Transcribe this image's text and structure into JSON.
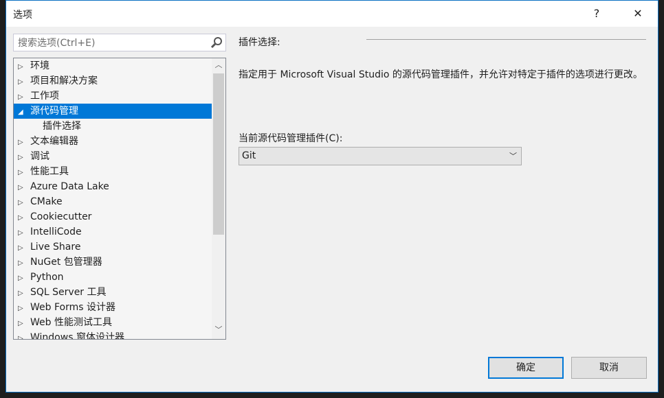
{
  "dialog": {
    "title": "选项",
    "help": "?",
    "close": "✕"
  },
  "search": {
    "placeholder": "搜索选项(Ctrl+E)"
  },
  "tree": {
    "items": [
      {
        "label": "环境",
        "expanded": false
      },
      {
        "label": "项目和解决方案",
        "expanded": false
      },
      {
        "label": "工作项",
        "expanded": false
      },
      {
        "label": "源代码管理",
        "expanded": true,
        "selected": true
      },
      {
        "label": "插件选择",
        "child": true
      },
      {
        "label": "文本编辑器",
        "expanded": false
      },
      {
        "label": "调试",
        "expanded": false
      },
      {
        "label": "性能工具",
        "expanded": false
      },
      {
        "label": "Azure Data Lake",
        "expanded": false
      },
      {
        "label": "CMake",
        "expanded": false
      },
      {
        "label": "Cookiecutter",
        "expanded": false
      },
      {
        "label": "IntelliCode",
        "expanded": false
      },
      {
        "label": "Live Share",
        "expanded": false
      },
      {
        "label": "NuGet 包管理器",
        "expanded": false
      },
      {
        "label": "Python",
        "expanded": false
      },
      {
        "label": "SQL Server 工具",
        "expanded": false
      },
      {
        "label": "Web Forms 设计器",
        "expanded": false
      },
      {
        "label": "Web 性能测试工具",
        "expanded": false
      },
      {
        "label": "Windows 窗体设计器",
        "expanded": false
      }
    ]
  },
  "panel": {
    "section": "插件选择:",
    "description": "指定用于 Microsoft Visual Studio 的源代码管理插件，并允许对特定于插件的选项进行更改。",
    "plugin_label": "当前源代码管理插件(C):",
    "plugin_value": "Git"
  },
  "buttons": {
    "ok": "确定",
    "cancel": "取消"
  },
  "colors": {
    "accent": "#0078d7"
  }
}
